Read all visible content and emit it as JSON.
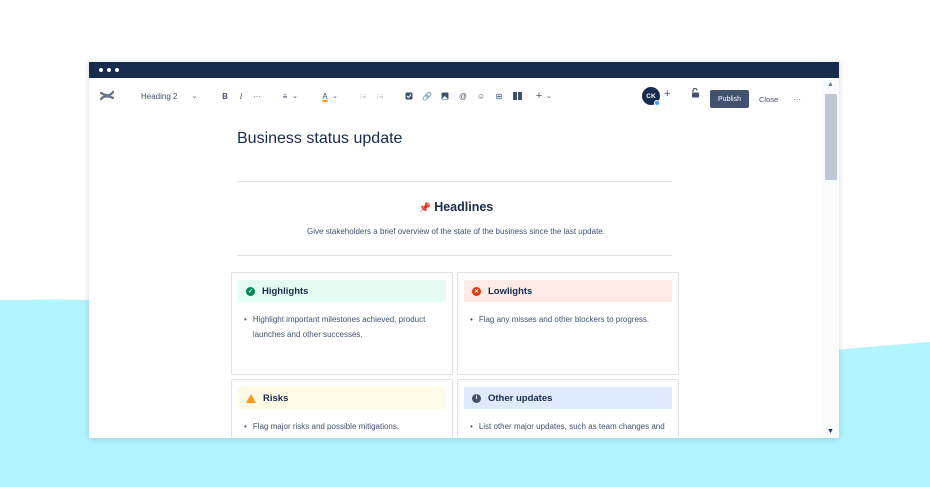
{
  "toolbar": {
    "heading_select": "Heading 2",
    "bold": "B",
    "italic": "I",
    "more_text": "···",
    "align": "≡",
    "text_color": "A",
    "insert_more": "+",
    "avatar_initials": "CK",
    "add_collaborator": "+",
    "publish_label": "Publish",
    "close_label": "Close",
    "more_label": "···"
  },
  "document": {
    "title": "Business status update",
    "headlines_title": "Headlines",
    "headlines_subtitle": "Give stakeholders a brief overview of the state of the business since the last update.",
    "cards": [
      {
        "title": "Highlights",
        "text": "Highlight important milestones achieved, product launches and other successes.",
        "color": "#e3fcef",
        "icon_color": "#00875a"
      },
      {
        "title": "Lowlights",
        "text": "Flag any misses and other blockers to progress.",
        "color": "#ffebe6",
        "icon_color": "#de350b"
      },
      {
        "title": "Risks",
        "text": "Flag major risks and possible mitigations.",
        "color": "#fffae6",
        "icon_color": "#ff991f"
      },
      {
        "title": "Other updates",
        "text": "List other major updates, such as team changes and learnings.",
        "color": "#deebff",
        "icon_color": "#42526e"
      }
    ]
  },
  "colors": {
    "titlebar": "#172b4d",
    "background_wave": "#b3f5ff",
    "publish_button": "#42526e"
  }
}
